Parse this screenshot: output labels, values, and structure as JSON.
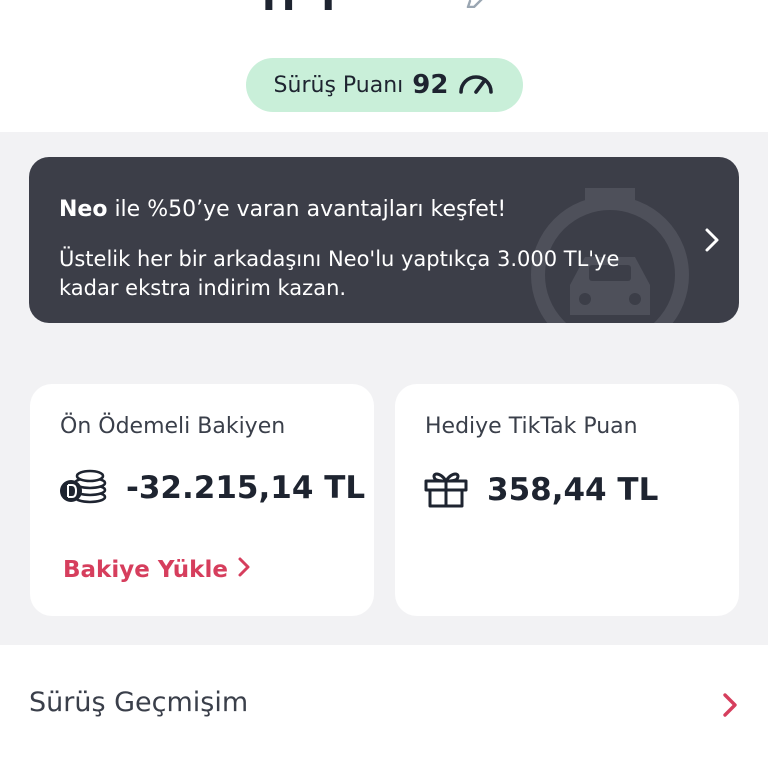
{
  "header": {
    "name_fragment": "ıı ı"
  },
  "score": {
    "label": "Sürüş Puanı",
    "value": "92",
    "icon": "speedometer-icon",
    "pill_color": "#c9efd9"
  },
  "banner": {
    "brand": "Neo",
    "headline_rest": " ile %50’ye varan avantajları keşfet!",
    "body": "Üstelik her bir arkadaşını Neo'lu yaptıkça 3.000 TL'ye kadar ekstra indirim kazan.",
    "background": "#3c3e48"
  },
  "cards": {
    "balance": {
      "title": "Ön Ödemeli Bakiyen",
      "amount": "-32.215,14 TL",
      "icon": "coins-icon",
      "link": "Bakiye Yükle"
    },
    "gift": {
      "title": "Hediye TikTak Puan",
      "amount": "358,44 TL",
      "icon": "gift-icon"
    }
  },
  "history": {
    "label": "Sürüş Geçmişim"
  },
  "colors": {
    "accent": "#d63e5d",
    "text_dark": "#1e2430",
    "page_bg": "#f2f2f4"
  }
}
